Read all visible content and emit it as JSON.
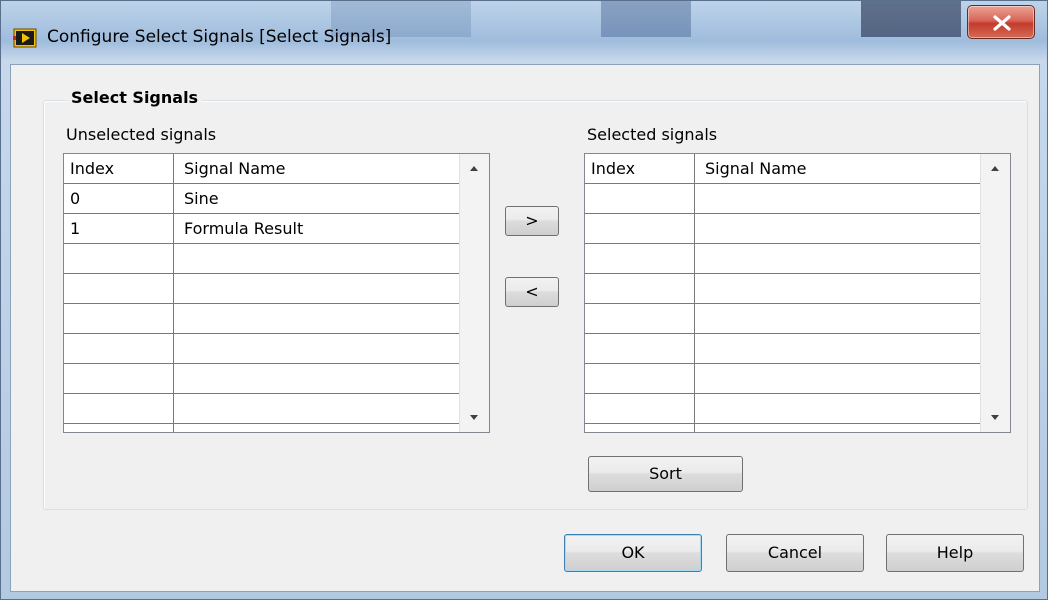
{
  "window": {
    "title": "Configure Select Signals [Select Signals]"
  },
  "group": {
    "title": "Select Signals"
  },
  "unselected": {
    "label": "Unselected signals",
    "columns": [
      "Index",
      "Signal Name"
    ],
    "rows": [
      {
        "index": "0",
        "name": "Sine"
      },
      {
        "index": "1",
        "name": "Formula Result"
      }
    ]
  },
  "selected": {
    "label": "Selected signals",
    "columns": [
      "Index",
      "Signal Name"
    ],
    "rows": []
  },
  "buttons": {
    "add": ">",
    "remove": "<",
    "sort": "Sort",
    "ok": "OK",
    "cancel": "Cancel",
    "help": "Help"
  },
  "icons": {
    "app": "labview-express-vi-icon",
    "close": "close-icon",
    "scroll_up": "scroll-up-arrow-icon",
    "scroll_down": "scroll-down-arrow-icon"
  },
  "colors": {
    "close_button": "#c33c2a",
    "dialog_bg": "#f0f0f0",
    "default_button_border": "#3c7fb1"
  }
}
